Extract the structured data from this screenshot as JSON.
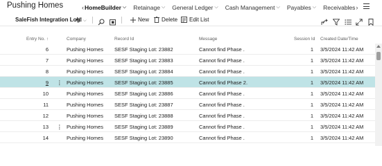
{
  "app": {
    "title": "Pushing Homes"
  },
  "nav": {
    "items": [
      {
        "label": "HomeBuilder",
        "active": true,
        "has_chevron": true
      },
      {
        "label": "Retainage",
        "active": false,
        "has_chevron": true
      },
      {
        "label": "General Ledger",
        "active": false,
        "has_chevron": true
      },
      {
        "label": "Cash Management",
        "active": false,
        "has_chevron": true
      },
      {
        "label": "Payables",
        "active": false,
        "has_chevron": true
      },
      {
        "label": "Receivables",
        "active": false,
        "has_chevron": false
      }
    ]
  },
  "toolbar": {
    "label": "SaleFish Integration Log:",
    "filter_value": "All",
    "new_label": "New",
    "delete_label": "Delete",
    "edit_list_label": "Edit List"
  },
  "grid": {
    "columns": {
      "entry_no": "Entry No. ↑",
      "company": "Company",
      "record_id": "Record Id",
      "message": "Message",
      "session_id": "Session Id",
      "created": "Created Date/Time"
    },
    "rows": [
      {
        "entry_no": "6",
        "company": "Pushing Homes",
        "record_id": "SESF Staging Lot: 23882",
        "message": "Cannot find Phase .",
        "session_id": "1",
        "created": "3/5/2024 11:42 AM",
        "selected": false,
        "show_dots": false
      },
      {
        "entry_no": "7",
        "company": "Pushing Homes",
        "record_id": "SESF Staging Lot: 23883",
        "message": "Cannot find Phase .",
        "session_id": "1",
        "created": "3/5/2024 11:42 AM",
        "selected": false,
        "show_dots": false
      },
      {
        "entry_no": "8",
        "company": "Pushing Homes",
        "record_id": "SESF Staging Lot: 23884",
        "message": "Cannot find Phase .",
        "session_id": "1",
        "created": "3/5/2024 11:42 AM",
        "selected": false,
        "show_dots": false
      },
      {
        "entry_no": "9",
        "company": "Pushing Homes",
        "record_id": "SESF Staging Lot: 23885",
        "message": "Cannot find Phase 2.",
        "session_id": "1",
        "created": "3/5/2024 11:42 AM",
        "selected": true,
        "show_dots": true
      },
      {
        "entry_no": "10",
        "company": "Pushing Homes",
        "record_id": "SESF Staging Lot: 23886",
        "message": "Cannot find Phase .",
        "session_id": "1",
        "created": "3/5/2024 11:42 AM",
        "selected": false,
        "show_dots": false
      },
      {
        "entry_no": "11",
        "company": "Pushing Homes",
        "record_id": "SESF Staging Lot: 23887",
        "message": "Cannot find Phase .",
        "session_id": "1",
        "created": "3/5/2024 11:42 AM",
        "selected": false,
        "show_dots": false
      },
      {
        "entry_no": "12",
        "company": "Pushing Homes",
        "record_id": "SESF Staging Lot: 23888",
        "message": "Cannot find Phase .",
        "session_id": "1",
        "created": "3/5/2024 11:42 AM",
        "selected": false,
        "show_dots": false
      },
      {
        "entry_no": "13",
        "company": "Pushing Homes",
        "record_id": "SESF Staging Lot: 23889",
        "message": "Cannot find Phase .",
        "session_id": "1",
        "created": "3/5/2024 11:42 AM",
        "selected": false,
        "show_dots": true
      },
      {
        "entry_no": "14",
        "company": "Pushing Homes",
        "record_id": "SESF Staging Lot: 23890",
        "message": "Cannot find Phase .",
        "session_id": "1",
        "created": "3/5/2024 11:42 AM",
        "selected": false,
        "show_dots": false
      }
    ]
  },
  "icons": {
    "search": "search-icon",
    "open_in_excel": "share-page-icon",
    "share": "share-icon",
    "filter": "filter-icon",
    "list_view": "list-view-icon",
    "expand": "expand-icon",
    "bookmark": "bookmark-icon",
    "menu": "hamburger-menu-icon"
  },
  "colors": {
    "selected_row": "#bfe3e6",
    "accent": "#0078d4"
  }
}
